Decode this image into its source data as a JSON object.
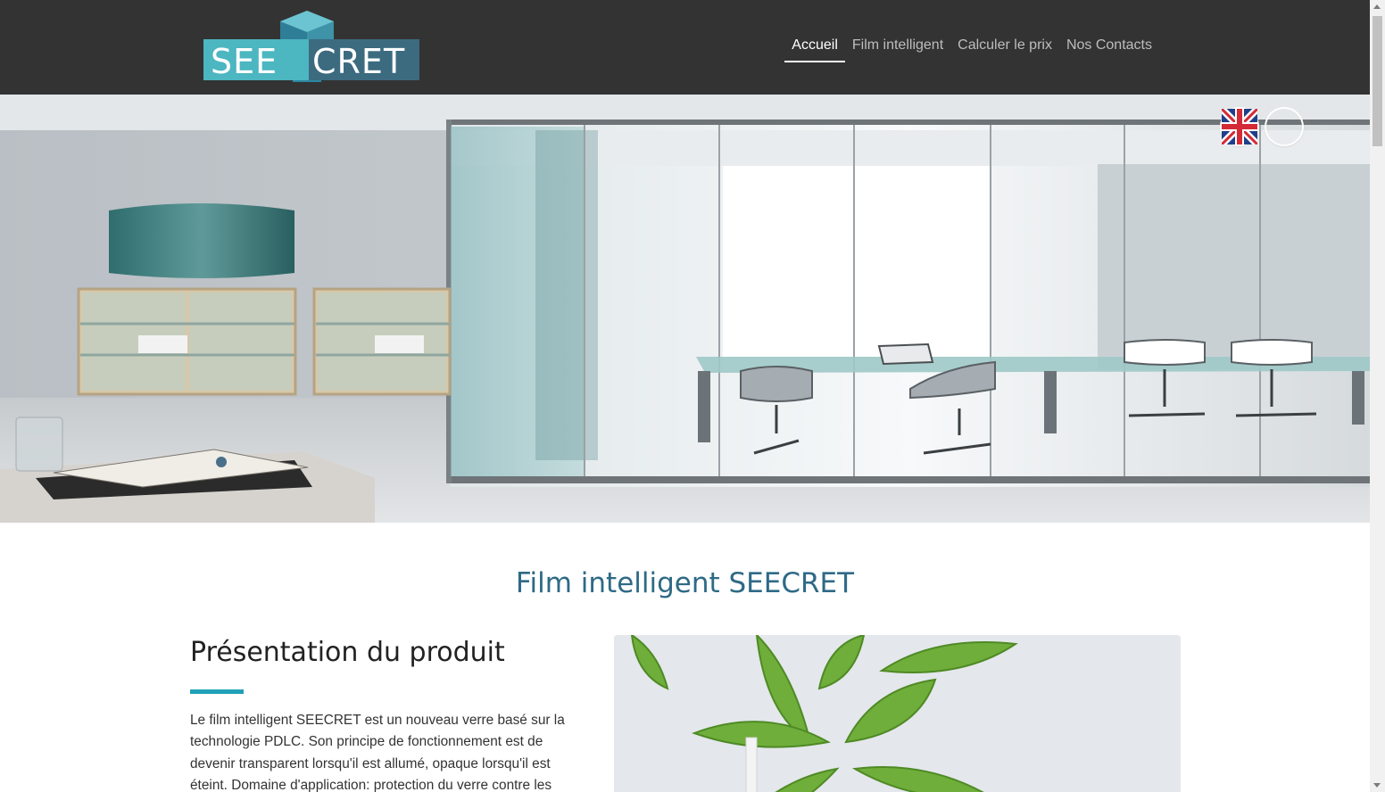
{
  "brand": {
    "logo_part1": "SEE",
    "logo_part2": "CRET",
    "logo_colors": {
      "teal": "#4cb6c1",
      "slate": "#3c6b7f"
    }
  },
  "nav": {
    "items": [
      {
        "label": "Accueil",
        "active": true
      },
      {
        "label": "Film intelligent",
        "active": false
      },
      {
        "label": "Calculer le prix",
        "active": false
      },
      {
        "label": "Nos Contacts",
        "active": false
      }
    ]
  },
  "languages": [
    {
      "code": "fr",
      "icon": "flag-france-icon"
    },
    {
      "code": "en",
      "icon": "flag-uk-icon"
    }
  ],
  "hero": {
    "icon": "office-glass-partition-photo"
  },
  "section": {
    "title": "Film intelligent SEECRET",
    "heading": "Présentation du produit",
    "paragraph": "Le film intelligent SEECRET est un nouveau verre basé sur la technologie PDLC. Son principe de fonctionnement est de devenir transparent lorsqu'il est allumé, opaque lorsqu'il est éteint. Domaine d'application: protection du verre contre les",
    "image_icon": "plant-photo"
  },
  "colors": {
    "header_bg": "#333333",
    "title": "#2e6a86",
    "accent": "#21a0b8"
  }
}
